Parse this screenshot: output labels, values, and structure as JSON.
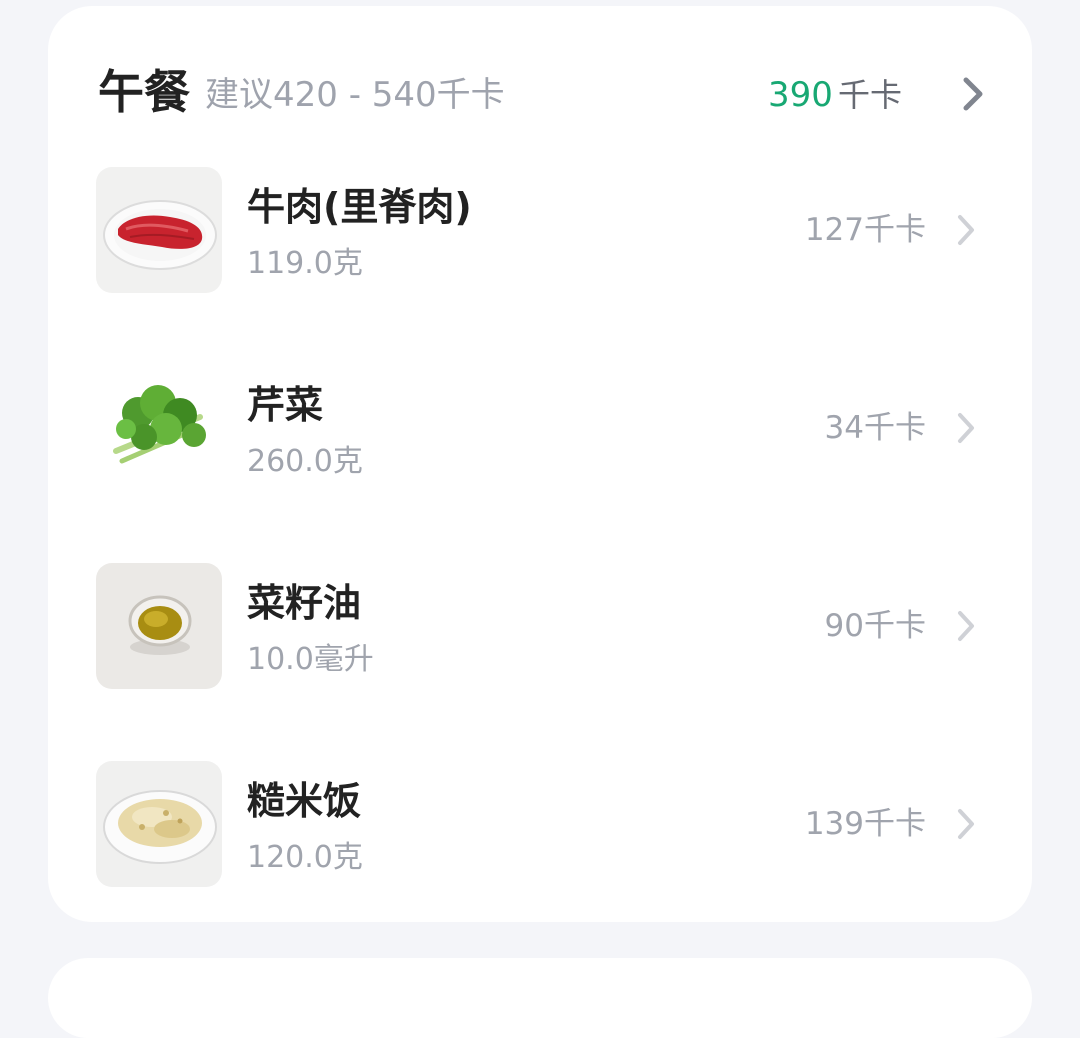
{
  "meal": {
    "title": "午餐",
    "suggestion": "建议420 - 540千卡",
    "total_kcal": "390",
    "total_unit": "千卡",
    "accent_color": "#18a873"
  },
  "foods": [
    {
      "name": "牛肉(里脊肉)",
      "amount": "119.0克",
      "kcal": "127千卡",
      "image": "raw-beef-on-plate"
    },
    {
      "name": "芹菜",
      "amount": "260.0克",
      "kcal": "34千卡",
      "image": "celery-bunch"
    },
    {
      "name": "菜籽油",
      "amount": "10.0毫升",
      "kcal": "90千卡",
      "image": "oil-in-glass-bowl"
    },
    {
      "name": "糙米饭",
      "amount": "120.0克",
      "kcal": "139千卡",
      "image": "brown-rice-on-plate"
    }
  ],
  "icons": {
    "chevron": "chevron-right-icon"
  }
}
